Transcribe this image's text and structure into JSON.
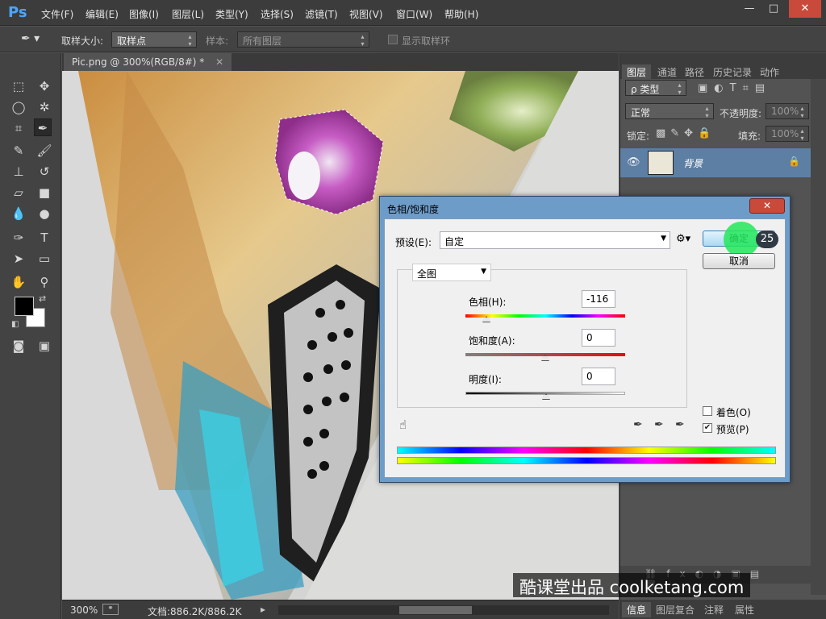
{
  "app": {
    "logo": "Ps",
    "menu": [
      "文件(F)",
      "编辑(E)",
      "图像(I)",
      "图层(L)",
      "类型(Y)",
      "选择(S)",
      "滤镜(T)",
      "视图(V)",
      "窗口(W)",
      "帮助(H)"
    ],
    "window_controls": {
      "minimize": "—",
      "maximize": "□",
      "close": "✕"
    }
  },
  "options_bar": {
    "sample_size_label": "取样大小:",
    "sample_size_value": "取样点",
    "sample_label": "样本:",
    "sample_value": "所有图层",
    "show_ring_label": "显示取样环"
  },
  "document": {
    "tab_title": "Pic.png @ 300%(RGB/8#) *",
    "tab_close": "✕",
    "zoom": "300%",
    "doc_info": "文档:886.2K/886.2K"
  },
  "layers_panel": {
    "tabs": [
      "图层",
      "通道",
      "路径",
      "历史记录",
      "动作"
    ],
    "filter_label": "ρ 类型",
    "blend_mode": "正常",
    "opacity_label": "不透明度:",
    "opacity_value": "100%",
    "lock_label": "锁定:",
    "fill_label": "填充:",
    "fill_value": "100%",
    "layer_name": "背景",
    "bottom_tabs": [
      "信息",
      "图层复合",
      "注释",
      "属性"
    ]
  },
  "dialog": {
    "title": "色相/饱和度",
    "close": "✕",
    "preset_label": "预设(E):",
    "preset_value": "自定",
    "channel_value": "全图",
    "hue_label": "色相(H):",
    "hue_value": "-116",
    "saturation_label": "饱和度(A):",
    "saturation_value": "0",
    "lightness_label": "明度(I):",
    "lightness_value": "0",
    "ok_label": "确定",
    "cancel_label": "取消",
    "colorize_label": "着色(O)",
    "preview_label": "预览(P)",
    "colorize_checked": false,
    "preview_checked": true,
    "step_badge": "25"
  },
  "watermark": {
    "text": "酷课堂出品 coolketang.com"
  },
  "colors": {
    "accent_blue": "#4aa6ff",
    "dialog_frame": "#6e9cc9",
    "close_red": "#c94a3a",
    "highlight_green": "#22e85a",
    "layer_selected": "#5d7fa3"
  }
}
